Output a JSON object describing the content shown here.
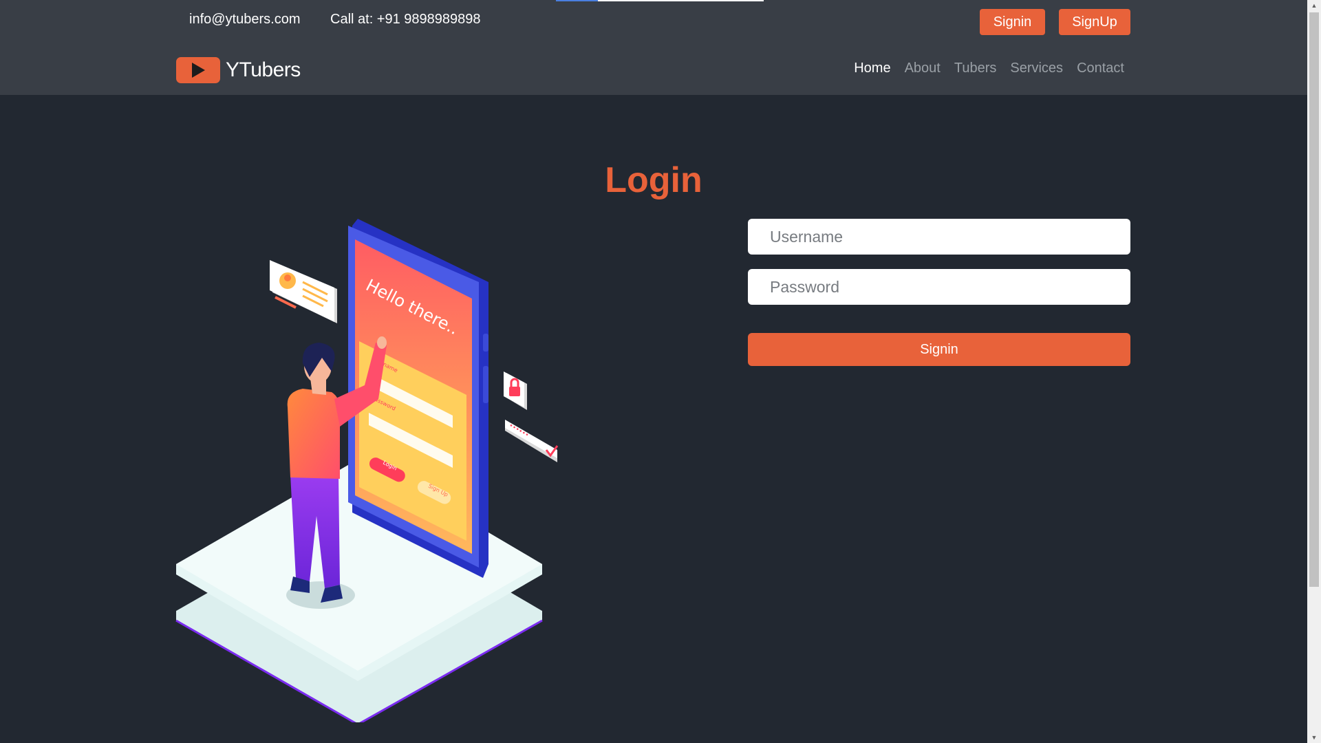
{
  "topbar": {
    "email": "info@ytubers.com",
    "phone": "Call at: +91 9898989898",
    "signin_label": "Signin",
    "signup_label": "SignUp"
  },
  "navbar": {
    "brand": "YTubers",
    "links": [
      "Home",
      "About",
      "Tubers",
      "Services",
      "Contact"
    ],
    "active": "Home"
  },
  "login": {
    "title": "Login",
    "username_placeholder": "Username",
    "password_placeholder": "Password",
    "submit_label": "Signin"
  },
  "illustration": {
    "screen_text": "Hello there..",
    "username_label": "Username",
    "password_label": "Password",
    "login_button": "Login",
    "signup_button": "Sign Up",
    "password_mask": "••••••"
  },
  "colors": {
    "background": "#222831",
    "header": "#393e46",
    "accent": "#e8623a",
    "phone_frame": "#3a4ad8"
  },
  "icons": {
    "logo": "play-icon",
    "lock": "lock-icon",
    "check": "check-icon",
    "profile": "profile-card-icon"
  }
}
